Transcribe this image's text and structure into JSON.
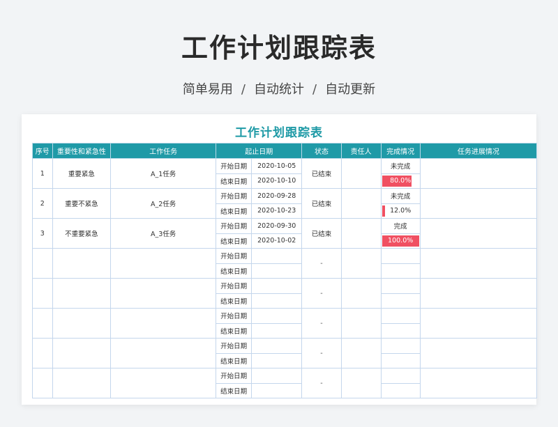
{
  "page": {
    "title": "工作计划跟踪表",
    "subtitle_parts": [
      "简单易用",
      "自动统计",
      "自动更新"
    ],
    "separator": "/"
  },
  "sheet": {
    "title": "工作计划跟踪表",
    "headers": [
      "序号",
      "重要性和紧急性",
      "工作任务",
      "起止日期",
      "状态",
      "责任人",
      "完成情况",
      "任务进展情况"
    ],
    "start_label": "开始日期",
    "end_label": "结束日期",
    "rows": [
      {
        "no": "1",
        "priority": "重要紧急",
        "task": "A_1任务",
        "start": "2020-10-05",
        "end": "2020-10-10",
        "status": "已结束",
        "owner": "",
        "completion_text": "未完成",
        "progress_label": "80.0%",
        "progress": 0.8,
        "notes": ""
      },
      {
        "no": "2",
        "priority": "重要不紧急",
        "task": "A_2任务",
        "start": "2020-09-28",
        "end": "2020-10-23",
        "status": "已结束",
        "owner": "",
        "completion_text": "未完成",
        "progress_label": "12.0%",
        "progress": 0.12,
        "notes": ""
      },
      {
        "no": "3",
        "priority": "不重要紧急",
        "task": "A_3任务",
        "start": "2020-09-30",
        "end": "2020-10-02",
        "status": "已结束",
        "owner": "",
        "completion_text": "完成",
        "progress_label": "100.0%",
        "progress": 1.0,
        "notes": ""
      },
      {
        "no": "",
        "priority": "",
        "task": "",
        "start": "",
        "end": "",
        "status": "-",
        "owner": "",
        "completion_text": "",
        "progress_label": "",
        "progress": 0,
        "notes": ""
      },
      {
        "no": "",
        "priority": "",
        "task": "",
        "start": "",
        "end": "",
        "status": "-",
        "owner": "",
        "completion_text": "",
        "progress_label": "",
        "progress": 0,
        "notes": ""
      },
      {
        "no": "",
        "priority": "",
        "task": "",
        "start": "",
        "end": "",
        "status": "-",
        "owner": "",
        "completion_text": "",
        "progress_label": "",
        "progress": 0,
        "notes": ""
      },
      {
        "no": "",
        "priority": "",
        "task": "",
        "start": "",
        "end": "",
        "status": "-",
        "owner": "",
        "completion_text": "",
        "progress_label": "",
        "progress": 0,
        "notes": ""
      },
      {
        "no": "",
        "priority": "",
        "task": "",
        "start": "",
        "end": "",
        "status": "-",
        "owner": "",
        "completion_text": "",
        "progress_label": "",
        "progress": 0,
        "notes": ""
      }
    ]
  },
  "colors": {
    "header_bg": "#1f9aa7",
    "title_accent": "#1e9aa6",
    "progress_fill": "#f05062",
    "grid_border": "#c4d6ec"
  }
}
